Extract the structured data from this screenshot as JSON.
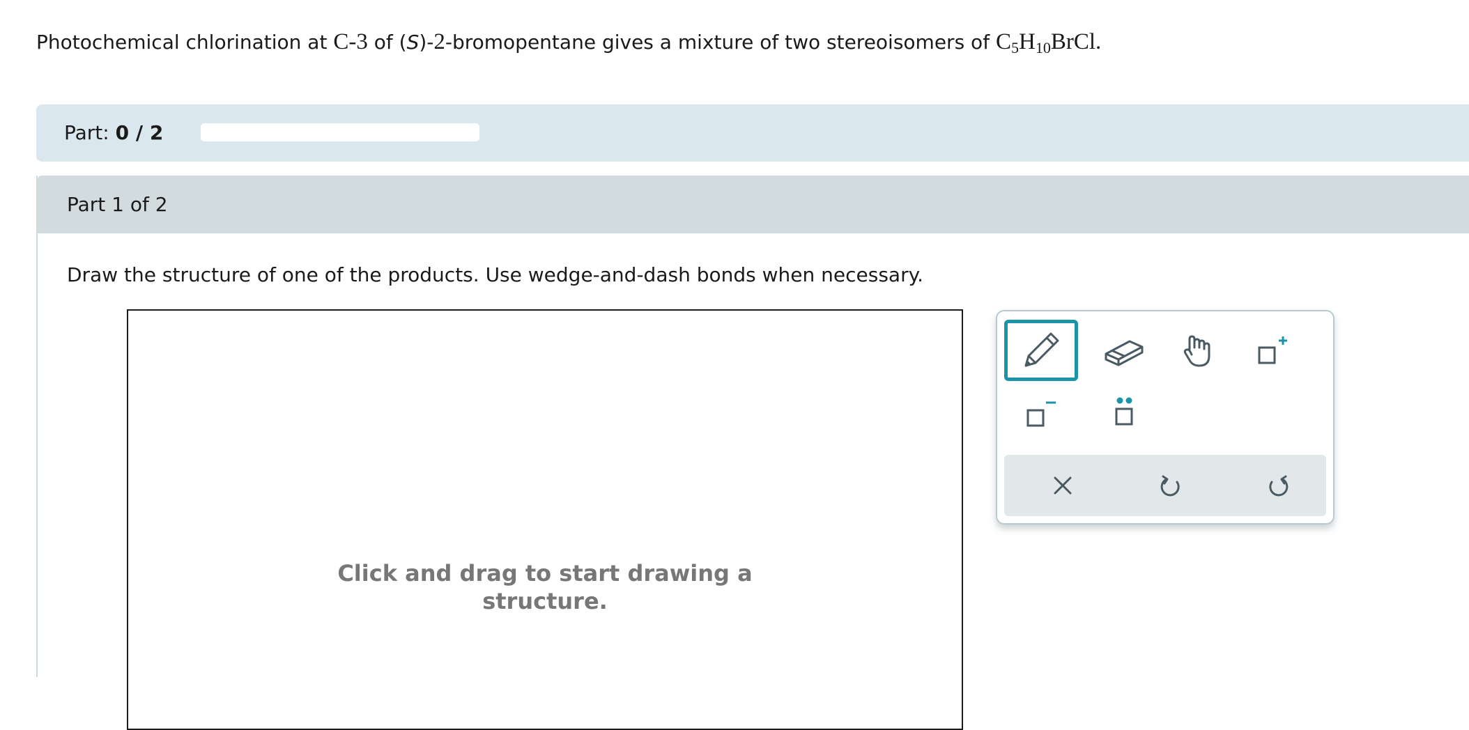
{
  "question": {
    "prefix": "Photochemical chlorination at ",
    "position": "C-3",
    "of_text": " of (",
    "config": "S",
    "close": ")-",
    "locant": "2",
    "name": "-bromopentane gives a mixture of two stereoisomers of ",
    "formula_c": "C",
    "formula_c_sub": "5",
    "formula_h": "H",
    "formula_h_sub": "10",
    "formula_rest": "BrCl."
  },
  "progress": {
    "label": "Part:",
    "value": "0 / 2",
    "fraction": 0
  },
  "part": {
    "header": "Part 1 of 2",
    "instructions": "Draw the structure of one of the products. Use wedge-and-dash bonds when necessary."
  },
  "canvas": {
    "hint_line1": "Click and drag to start drawing a",
    "hint_line2": "structure."
  },
  "toolbox": {
    "tools": [
      "pencil-icon",
      "eraser-icon",
      "hand-icon",
      "positive-charge-icon",
      "negative-charge-icon",
      "lone-pair-icon"
    ],
    "actions": [
      "clear-icon",
      "undo-icon",
      "redo-icon"
    ],
    "active_tool": "pencil-icon",
    "accent_color": "#1b93a8",
    "icon_color": "#4a5a63"
  }
}
